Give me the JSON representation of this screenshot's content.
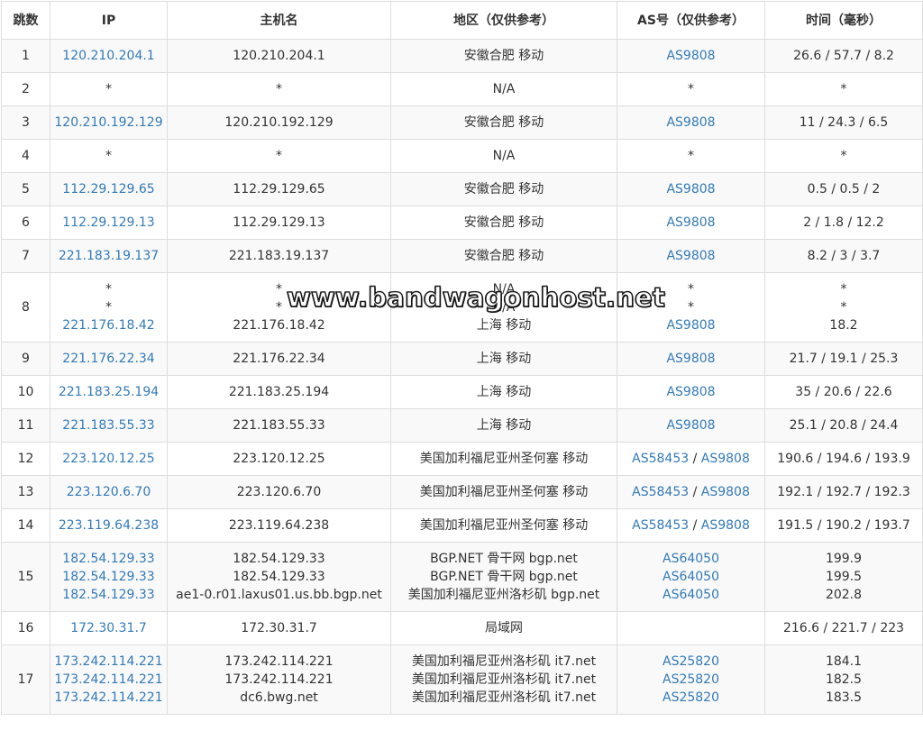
{
  "headers": {
    "hop": "跳数",
    "ip": "IP",
    "host": "主机名",
    "location": "地区（仅供参考）",
    "as": "AS号（仅供参考）",
    "time": "时间（毫秒）"
  },
  "watermark": "www.bandwagonhost.net",
  "rows": [
    {
      "hop": "1",
      "ip": [
        "120.210.204.1"
      ],
      "host": [
        "120.210.204.1"
      ],
      "loc": [
        "安徽合肥 移动"
      ],
      "as": [
        [
          "AS9808"
        ]
      ],
      "time": [
        "26.6 / 57.7 / 8.2"
      ]
    },
    {
      "hop": "2",
      "ip": [
        "*"
      ],
      "host": [
        "*"
      ],
      "loc": [
        "N/A"
      ],
      "as": [
        [
          "*"
        ]
      ],
      "time": [
        "*"
      ]
    },
    {
      "hop": "3",
      "ip": [
        "120.210.192.129"
      ],
      "host": [
        "120.210.192.129"
      ],
      "loc": [
        "安徽合肥 移动"
      ],
      "as": [
        [
          "AS9808"
        ]
      ],
      "time": [
        "11 / 24.3 / 6.5"
      ]
    },
    {
      "hop": "4",
      "ip": [
        "*"
      ],
      "host": [
        "*"
      ],
      "loc": [
        "N/A"
      ],
      "as": [
        [
          "*"
        ]
      ],
      "time": [
        "*"
      ]
    },
    {
      "hop": "5",
      "ip": [
        "112.29.129.65"
      ],
      "host": [
        "112.29.129.65"
      ],
      "loc": [
        "安徽合肥 移动"
      ],
      "as": [
        [
          "AS9808"
        ]
      ],
      "time": [
        "0.5 / 0.5 / 2"
      ]
    },
    {
      "hop": "6",
      "ip": [
        "112.29.129.13"
      ],
      "host": [
        "112.29.129.13"
      ],
      "loc": [
        "安徽合肥 移动"
      ],
      "as": [
        [
          "AS9808"
        ]
      ],
      "time": [
        "2 / 1.8 / 12.2"
      ]
    },
    {
      "hop": "7",
      "ip": [
        "221.183.19.137"
      ],
      "host": [
        "221.183.19.137"
      ],
      "loc": [
        "安徽合肥 移动"
      ],
      "as": [
        [
          "AS9808"
        ]
      ],
      "time": [
        "8.2 / 3 / 3.7"
      ]
    },
    {
      "hop": "8",
      "ip": [
        "*",
        "*",
        "221.176.18.42"
      ],
      "host": [
        "*",
        "*",
        "221.176.18.42"
      ],
      "loc": [
        "N/A",
        "N/A",
        "上海 移动"
      ],
      "as": [
        [
          "*"
        ],
        [
          "*"
        ],
        [
          "AS9808"
        ]
      ],
      "time": [
        "*",
        "*",
        "18.2"
      ]
    },
    {
      "hop": "9",
      "ip": [
        "221.176.22.34"
      ],
      "host": [
        "221.176.22.34"
      ],
      "loc": [
        "上海 移动"
      ],
      "as": [
        [
          "AS9808"
        ]
      ],
      "time": [
        "21.7 / 19.1 / 25.3"
      ]
    },
    {
      "hop": "10",
      "ip": [
        "221.183.25.194"
      ],
      "host": [
        "221.183.25.194"
      ],
      "loc": [
        "上海 移动"
      ],
      "as": [
        [
          "AS9808"
        ]
      ],
      "time": [
        "35 / 20.6 / 22.6"
      ]
    },
    {
      "hop": "11",
      "ip": [
        "221.183.55.33"
      ],
      "host": [
        "221.183.55.33"
      ],
      "loc": [
        "上海 移动"
      ],
      "as": [
        [
          "AS9808"
        ]
      ],
      "time": [
        "25.1 / 20.8 / 24.4"
      ]
    },
    {
      "hop": "12",
      "ip": [
        "223.120.12.25"
      ],
      "host": [
        "223.120.12.25"
      ],
      "loc": [
        "美国加利福尼亚州圣何塞 移动"
      ],
      "as": [
        [
          "AS58453",
          "AS9808"
        ]
      ],
      "time": [
        "190.6 / 194.6 / 193.9"
      ]
    },
    {
      "hop": "13",
      "ip": [
        "223.120.6.70"
      ],
      "host": [
        "223.120.6.70"
      ],
      "loc": [
        "美国加利福尼亚州圣何塞 移动"
      ],
      "as": [
        [
          "AS58453",
          "AS9808"
        ]
      ],
      "time": [
        "192.1 / 192.7 / 192.3"
      ]
    },
    {
      "hop": "14",
      "ip": [
        "223.119.64.238"
      ],
      "host": [
        "223.119.64.238"
      ],
      "loc": [
        "美国加利福尼亚州圣何塞 移动"
      ],
      "as": [
        [
          "AS58453",
          "AS9808"
        ]
      ],
      "time": [
        "191.5 / 190.2 / 193.7"
      ]
    },
    {
      "hop": "15",
      "ip": [
        "182.54.129.33",
        "182.54.129.33",
        "182.54.129.33"
      ],
      "host": [
        "182.54.129.33",
        "182.54.129.33",
        "ae1-0.r01.laxus01.us.bb.bgp.net"
      ],
      "loc": [
        "BGP.NET 骨干网 bgp.net",
        "BGP.NET 骨干网 bgp.net",
        "美国加利福尼亚州洛杉矶 bgp.net"
      ],
      "as": [
        [
          "AS64050"
        ],
        [
          "AS64050"
        ],
        [
          "AS64050"
        ]
      ],
      "time": [
        "199.9",
        "199.5",
        "202.8"
      ]
    },
    {
      "hop": "16",
      "ip": [
        "172.30.31.7"
      ],
      "host": [
        "172.30.31.7"
      ],
      "loc": [
        "局域网"
      ],
      "as": [
        []
      ],
      "time": [
        "216.6 / 221.7 / 223"
      ]
    },
    {
      "hop": "17",
      "ip": [
        "173.242.114.221",
        "173.242.114.221",
        "173.242.114.221"
      ],
      "host": [
        "173.242.114.221",
        "173.242.114.221",
        "dc6.bwg.net"
      ],
      "loc": [
        "美国加利福尼亚州洛杉矶 it7.net",
        "美国加利福尼亚州洛杉矶 it7.net",
        "美国加利福尼亚州洛杉矶 it7.net"
      ],
      "as": [
        [
          "AS25820"
        ],
        [
          "AS25820"
        ],
        [
          "AS25820"
        ]
      ],
      "time": [
        "184.1",
        "182.5",
        "183.5"
      ]
    }
  ]
}
